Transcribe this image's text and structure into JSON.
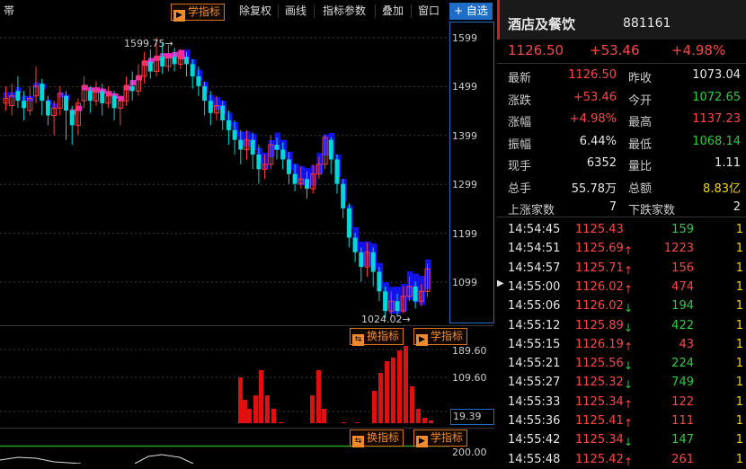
{
  "toolbar": {
    "left_label": "帯",
    "study_btn": "学指标",
    "items": [
      "除复权",
      "画线",
      "指标参数",
      "叠加",
      "窗口"
    ],
    "watchlist_btn": "+ 自选"
  },
  "chart": {
    "price_ticks": [
      "1599",
      "1499",
      "1399",
      "1299",
      "1199",
      "1099"
    ],
    "high_label": "1599.75",
    "low_label": "1024.02",
    "vol_ticks": [
      "189.60",
      "109.60",
      "19.39"
    ],
    "ind_ticks": [
      "200.00"
    ],
    "switch_btn": "换指标",
    "study_btn": "学指标"
  },
  "panel": {
    "name": "酒店及餐饮",
    "code": "881161",
    "price": "1126.50",
    "change": "+53.46",
    "pct": "+4.98%",
    "stats": [
      {
        "l1": "最新",
        "v1": "1126.50",
        "c1": "red",
        "l2": "昨收",
        "v2": "1073.04",
        "c2": "white"
      },
      {
        "l1": "涨跌",
        "v1": "+53.46",
        "c1": "red",
        "l2": "今开",
        "v2": "1072.65",
        "c2": "green"
      },
      {
        "l1": "涨幅",
        "v1": "+4.98%",
        "c1": "red",
        "l2": "最高",
        "v2": "1137.23",
        "c2": "red"
      },
      {
        "l1": "振幅",
        "v1": "6.44%",
        "c1": "white",
        "l2": "最低",
        "v2": "1068.14",
        "c2": "green"
      },
      {
        "l1": "现手",
        "v1": "6352",
        "c1": "white",
        "l2": "量比",
        "v2": "1.11",
        "c2": "white"
      },
      {
        "l1": "总手",
        "v1": "55.78万",
        "c1": "white",
        "l2": "总额",
        "v2": "8.83亿",
        "c2": "yellow"
      },
      {
        "l1": "上涨家数",
        "v1": "7",
        "c1": "white",
        "l2": "下跌家数",
        "v2": "2",
        "c2": "white"
      }
    ],
    "ticks": [
      {
        "t": "14:54:45",
        "p": "1125.43",
        "pc": "red",
        "dir": "",
        "v": "159",
        "vc": "green",
        "n": "1"
      },
      {
        "t": "14:54:51",
        "p": "1125.69",
        "pc": "red",
        "dir": "up",
        "v": "1223",
        "vc": "red",
        "n": "1"
      },
      {
        "t": "14:54:57",
        "p": "1125.71",
        "pc": "red",
        "dir": "up",
        "v": "156",
        "vc": "red",
        "n": "1"
      },
      {
        "t": "14:55:00",
        "p": "1126.02",
        "pc": "red",
        "dir": "up",
        "v": "474",
        "vc": "red",
        "n": "1"
      },
      {
        "t": "14:55:06",
        "p": "1126.02",
        "pc": "red",
        "dir": "down",
        "v": "194",
        "vc": "green",
        "n": "1"
      },
      {
        "t": "14:55:12",
        "p": "1125.89",
        "pc": "red",
        "dir": "down",
        "v": "422",
        "vc": "green",
        "n": "1"
      },
      {
        "t": "14:55:15",
        "p": "1126.19",
        "pc": "red",
        "dir": "up",
        "v": "43",
        "vc": "red",
        "n": "1"
      },
      {
        "t": "14:55:21",
        "p": "1125.56",
        "pc": "red",
        "dir": "down",
        "v": "224",
        "vc": "green",
        "n": "1"
      },
      {
        "t": "14:55:27",
        "p": "1125.32",
        "pc": "red",
        "dir": "down",
        "v": "749",
        "vc": "green",
        "n": "1"
      },
      {
        "t": "14:55:33",
        "p": "1125.34",
        "pc": "red",
        "dir": "up",
        "v": "122",
        "vc": "red",
        "n": "1"
      },
      {
        "t": "14:55:36",
        "p": "1125.41",
        "pc": "red",
        "dir": "up",
        "v": "111",
        "vc": "red",
        "n": "1"
      },
      {
        "t": "14:55:42",
        "p": "1125.34",
        "pc": "red",
        "dir": "down",
        "v": "147",
        "vc": "green",
        "n": "1"
      },
      {
        "t": "14:55:48",
        "p": "1125.42",
        "pc": "red",
        "dir": "up",
        "v": "261",
        "vc": "red",
        "n": "1"
      }
    ]
  },
  "chart_data": {
    "type": "candlestick",
    "candles": [
      [
        1475,
        1465,
        1500,
        1450,
        1
      ],
      [
        1460,
        1480,
        1505,
        1440,
        1
      ],
      [
        1490,
        1470,
        1520,
        1455,
        0
      ],
      [
        1470,
        1455,
        1490,
        1430,
        0
      ],
      [
        1450,
        1475,
        1500,
        1440,
        1
      ],
      [
        1480,
        1500,
        1540,
        1465,
        1
      ],
      [
        1505,
        1470,
        1515,
        1440,
        0
      ],
      [
        1470,
        1440,
        1480,
        1420,
        0
      ],
      [
        1440,
        1455,
        1470,
        1400,
        1
      ],
      [
        1455,
        1485,
        1500,
        1440,
        1
      ],
      [
        1480,
        1450,
        1490,
        1390,
        0
      ],
      [
        1450,
        1420,
        1460,
        1380,
        0
      ],
      [
        1420,
        1465,
        1475,
        1400,
        1
      ],
      [
        1470,
        1500,
        1520,
        1455,
        1
      ],
      [
        1490,
        1470,
        1500,
        1445,
        0
      ],
      [
        1470,
        1490,
        1510,
        1460,
        1
      ],
      [
        1490,
        1465,
        1505,
        1440,
        0
      ],
      [
        1465,
        1480,
        1500,
        1455,
        1
      ],
      [
        1480,
        1455,
        1490,
        1430,
        0
      ],
      [
        1455,
        1470,
        1480,
        1420,
        1
      ],
      [
        1470,
        1500,
        1520,
        1460,
        1
      ],
      [
        1500,
        1490,
        1530,
        1470,
        0
      ],
      [
        1490,
        1520,
        1545,
        1480,
        1
      ],
      [
        1520,
        1550,
        1570,
        1505,
        1
      ],
      [
        1550,
        1530,
        1575,
        1515,
        0
      ],
      [
        1530,
        1560,
        1600,
        1520,
        1
      ],
      [
        1560,
        1540,
        1590,
        1525,
        0
      ],
      [
        1540,
        1560,
        1585,
        1530,
        1
      ],
      [
        1560,
        1545,
        1578,
        1530,
        0
      ],
      [
        1545,
        1560,
        1575,
        1535,
        1
      ],
      [
        1560,
        1545,
        1570,
        1520,
        0
      ],
      [
        1545,
        1520,
        1555,
        1495,
        0
      ],
      [
        1520,
        1500,
        1540,
        1480,
        0
      ],
      [
        1500,
        1470,
        1510,
        1440,
        0
      ],
      [
        1470,
        1445,
        1490,
        1420,
        0
      ],
      [
        1445,
        1460,
        1480,
        1430,
        1
      ],
      [
        1460,
        1430,
        1470,
        1410,
        0
      ],
      [
        1430,
        1410,
        1450,
        1380,
        0
      ],
      [
        1410,
        1390,
        1430,
        1360,
        0
      ],
      [
        1390,
        1370,
        1410,
        1340,
        0
      ],
      [
        1370,
        1390,
        1410,
        1350,
        1
      ],
      [
        1390,
        1360,
        1405,
        1330,
        0
      ],
      [
        1360,
        1330,
        1380,
        1300,
        0
      ],
      [
        1330,
        1340,
        1360,
        1310,
        1
      ],
      [
        1340,
        1380,
        1400,
        1330,
        1
      ],
      [
        1380,
        1370,
        1395,
        1350,
        0
      ],
      [
        1370,
        1350,
        1385,
        1330,
        0
      ],
      [
        1350,
        1320,
        1365,
        1300,
        0
      ],
      [
        1320,
        1300,
        1340,
        1285,
        0
      ],
      [
        1300,
        1310,
        1335,
        1290,
        1
      ],
      [
        1310,
        1290,
        1325,
        1270,
        0
      ],
      [
        1290,
        1320,
        1340,
        1280,
        1
      ],
      [
        1320,
        1340,
        1355,
        1310,
        1
      ],
      [
        1340,
        1395,
        1400,
        1330,
        1
      ],
      [
        1390,
        1350,
        1395,
        1320,
        0
      ],
      [
        1350,
        1300,
        1360,
        1280,
        0
      ],
      [
        1300,
        1250,
        1310,
        1230,
        0
      ],
      [
        1250,
        1190,
        1260,
        1170,
        0
      ],
      [
        1190,
        1160,
        1200,
        1140,
        0
      ],
      [
        1160,
        1130,
        1170,
        1100,
        0
      ],
      [
        1130,
        1160,
        1180,
        1110,
        1
      ],
      [
        1160,
        1120,
        1170,
        1090,
        0
      ],
      [
        1120,
        1080,
        1130,
        1060,
        0
      ],
      [
        1080,
        1040,
        1090,
        1025,
        0
      ],
      [
        1040,
        1060,
        1080,
        1030,
        1
      ],
      [
        1060,
        1040,
        1075,
        1030,
        0
      ],
      [
        1040,
        1070,
        1090,
        1035,
        1
      ],
      [
        1070,
        1090,
        1110,
        1060,
        1
      ],
      [
        1090,
        1060,
        1100,
        1045,
        0
      ],
      [
        1060,
        1080,
        1095,
        1050,
        1
      ],
      [
        1080,
        1126,
        1137,
        1068,
        1
      ]
    ],
    "volume_range": [
      19.39,
      189.6
    ],
    "ylim": [
      1024.02,
      1599.75
    ]
  }
}
